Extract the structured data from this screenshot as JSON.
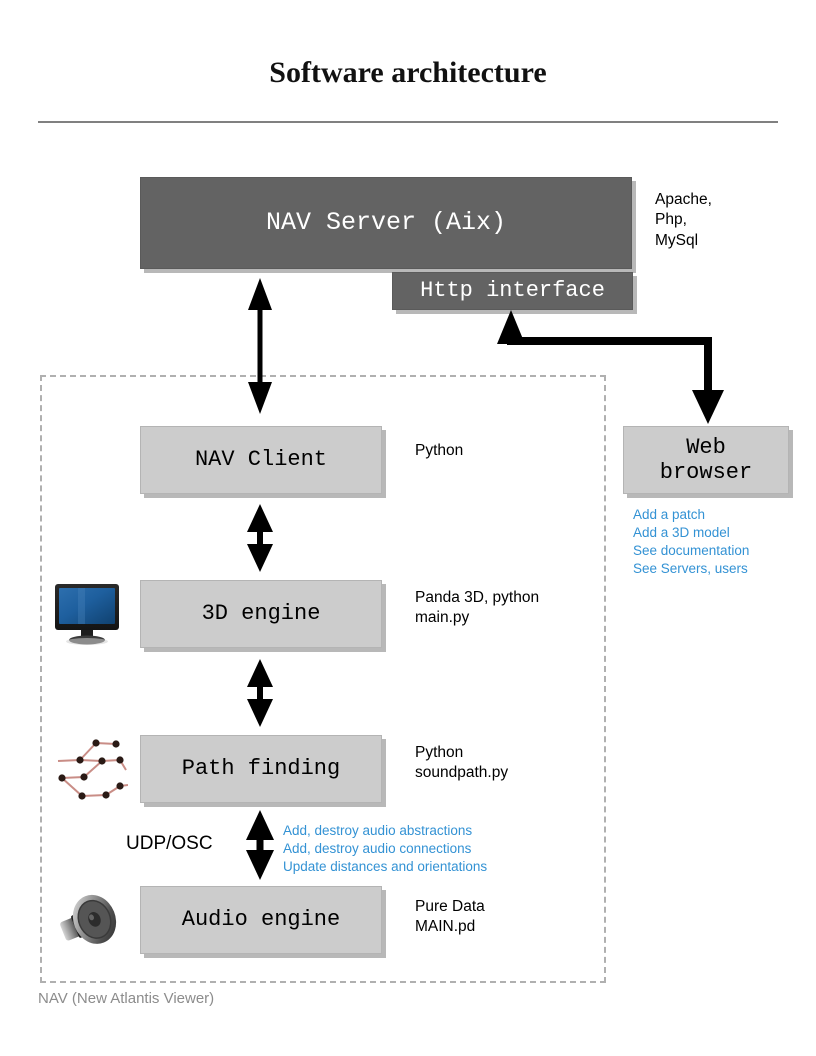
{
  "title": "Software architecture",
  "boxes": {
    "nav_server": "NAV Server (Aix)",
    "http_interface": "Http interface",
    "nav_client": "NAV Client",
    "engine_3d": "3D engine",
    "path_finding": "Path finding",
    "audio_engine": "Audio engine",
    "web_browser_line1": "Web",
    "web_browser_line2": "browser"
  },
  "annotations": {
    "server_stack": "Apache,\nPhp,\nMySql",
    "nav_client_tech": "Python",
    "engine_3d_tech": "Panda 3D, python\nmain.py",
    "path_finding_tech": "Python\nsoundpath.py",
    "audio_engine_tech": "Pure Data\nMAIN.pd",
    "udp_osc_label": "UDP/OSC"
  },
  "browser_links": [
    "Add a patch",
    "Add a 3D model",
    "See documentation",
    "See Servers, users"
  ],
  "osc_messages": [
    "Add, destroy audio abstractions",
    "Add, destroy audio connections",
    "Update distances and orientations"
  ],
  "zone_caption": "NAV (New Atlantis Viewer)",
  "colors": {
    "dark_box": "#636363",
    "light_box": "#cccccc",
    "link_blue": "#3392d4",
    "caption_gray": "#8c8c8c",
    "rule_gray": "#808080"
  }
}
